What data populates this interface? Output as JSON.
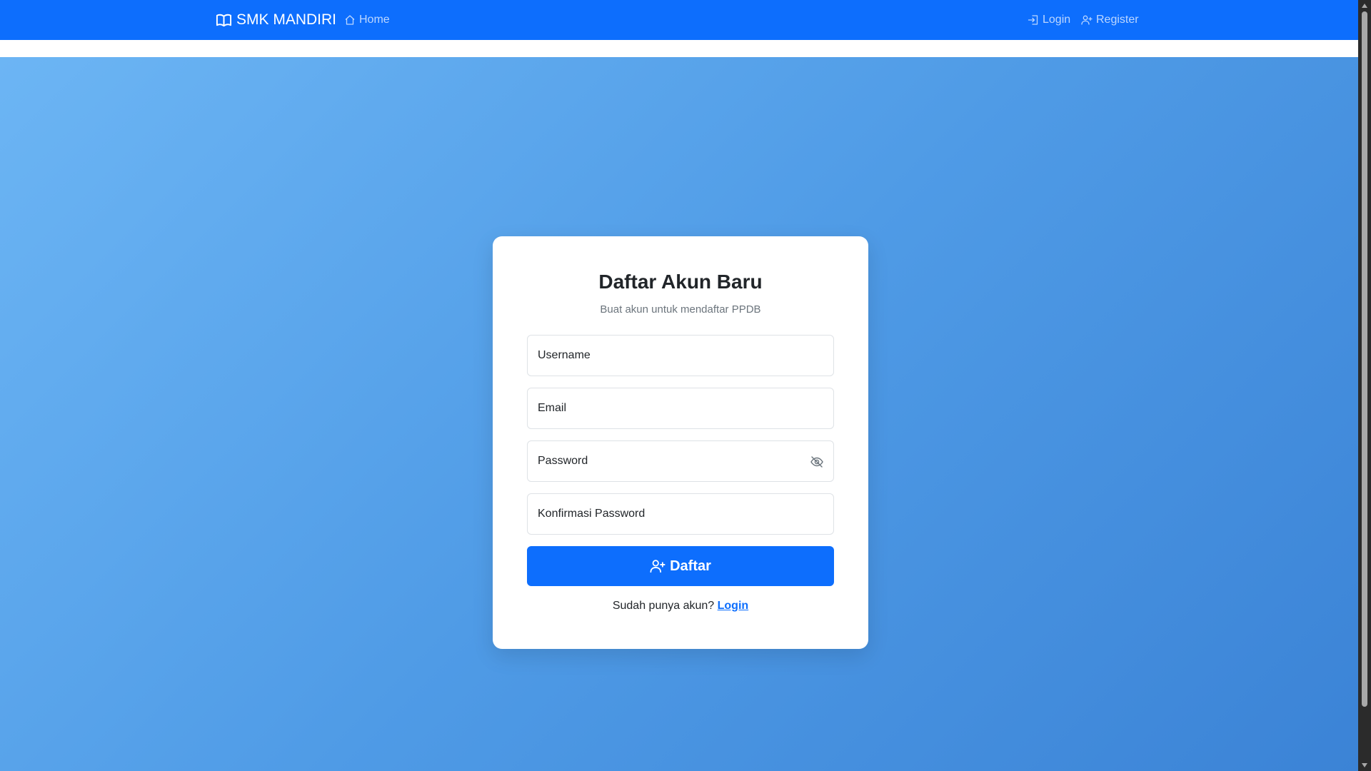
{
  "navbar": {
    "brand": "SMK MANDIRI",
    "brand_icon": "book-icon",
    "home_label": "Home",
    "login_label": "Login",
    "register_label": "Register"
  },
  "form": {
    "title": "Daftar Akun Baru",
    "subtitle": "Buat akun untuk mendaftar PPDB",
    "username_placeholder": "Username",
    "email_placeholder": "Email",
    "password_placeholder": "Password",
    "confirm_placeholder": "Konfirmasi Password",
    "submit_label": "Daftar",
    "footer_text": "Sudah punya akun?",
    "footer_link": "Login"
  },
  "colors": {
    "primary": "#0d6efd",
    "gradient_start": "#6cb5f4",
    "gradient_end": "#3b83d6"
  }
}
